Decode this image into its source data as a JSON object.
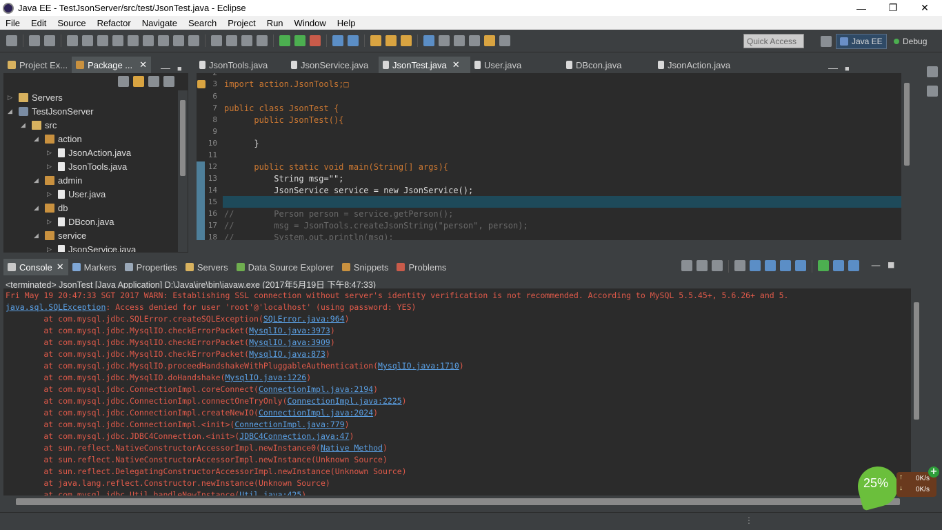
{
  "window": {
    "title": "Java EE - TestJsonServer/src/test/JsonTest.java - Eclipse",
    "minimize": "—",
    "maximize": "❐",
    "close": "✕"
  },
  "menu": [
    "File",
    "Edit",
    "Source",
    "Refactor",
    "Navigate",
    "Search",
    "Project",
    "Run",
    "Window",
    "Help"
  ],
  "toolbar": {
    "quick_access": "Quick Access",
    "perspectives": [
      "Java EE",
      "Debug"
    ]
  },
  "left_tabs": [
    {
      "label": "Project Ex..."
    },
    {
      "label": "Package ...",
      "close": "✕"
    }
  ],
  "tree": [
    {
      "label": "Servers",
      "depth": 0,
      "icon": "folder",
      "expanded": false
    },
    {
      "label": "TestJsonServer",
      "depth": 0,
      "icon": "project",
      "expanded": true
    },
    {
      "label": "src",
      "depth": 1,
      "icon": "folder",
      "expanded": true
    },
    {
      "label": "action",
      "depth": 2,
      "icon": "pkg",
      "expanded": true
    },
    {
      "label": "JsonAction.java",
      "depth": 3,
      "icon": "file",
      "expanded": false
    },
    {
      "label": "JsonTools.java",
      "depth": 3,
      "icon": "file",
      "expanded": false
    },
    {
      "label": "admin",
      "depth": 2,
      "icon": "pkg",
      "expanded": true
    },
    {
      "label": "User.java",
      "depth": 3,
      "icon": "file",
      "expanded": false
    },
    {
      "label": "db",
      "depth": 2,
      "icon": "pkg",
      "expanded": true
    },
    {
      "label": "DBcon.java",
      "depth": 3,
      "icon": "file",
      "expanded": false
    },
    {
      "label": "service",
      "depth": 2,
      "icon": "pkg",
      "expanded": true
    },
    {
      "label": "JsonService.java",
      "depth": 3,
      "icon": "file",
      "expanded": false
    }
  ],
  "editor_tabs": [
    {
      "label": "JsonTools.java",
      "active": false
    },
    {
      "label": "JsonService.java",
      "active": false
    },
    {
      "label": "JsonTest.java",
      "active": true,
      "close": "✕"
    },
    {
      "label": "User.java",
      "active": false
    },
    {
      "label": "DBcon.java",
      "active": false
    },
    {
      "label": "JsonAction.java",
      "active": false
    }
  ],
  "code_lines": [
    {
      "num": "2",
      "text": ""
    },
    {
      "num": "3",
      "text": "import action.JsonTools;□"
    },
    {
      "num": "6",
      "text": ""
    },
    {
      "num": "7",
      "text": "public class JsonTest {"
    },
    {
      "num": "8",
      "text": "      public JsonTest(){"
    },
    {
      "num": "9",
      "text": ""
    },
    {
      "num": "10",
      "text": "      }"
    },
    {
      "num": "11",
      "text": ""
    },
    {
      "num": "12",
      "text": "      public static void main(String[] args){"
    },
    {
      "num": "13",
      "text": "          String msg=\"\";"
    },
    {
      "num": "14",
      "text": "          JsonService service = new JsonService();"
    },
    {
      "num": "15",
      "text": ""
    },
    {
      "num": "16",
      "text": "//        Person person = service.getPerson();"
    },
    {
      "num": "17",
      "text": "//        msg = JsonTools.createJsonString(\"person\", person);"
    },
    {
      "num": "18",
      "text": "//        System.out.println(msg);"
    }
  ],
  "console_tabs": [
    "Console",
    "Markers",
    "Properties",
    "Servers",
    "Data Source Explorer",
    "Snippets",
    "Problems"
  ],
  "console_close": "✕",
  "console_header": "<terminated> JsonTest [Java Application] D:\\Java\\jre\\bin\\javaw.exe (2017年5月19日 下午8:47:33)",
  "console_lines": [
    {
      "pre": "Fri May 19 20:47:33 SGT 2017 WARN: Establishing SSL connection without server's identity verification is not recommended. According to MySQL 5.5.45+, 5.6.26+ and 5.",
      "link": "",
      "post": ""
    },
    {
      "pre": "",
      "link": "java.sql.SQLException",
      "post": ": Access denied for user 'root'@'localhost' (using password: YES)"
    },
    {
      "pre": "        at com.mysql.jdbc.SQLError.createSQLException(",
      "link": "SQLError.java:964",
      "post": ")"
    },
    {
      "pre": "        at com.mysql.jdbc.MysqlIO.checkErrorPacket(",
      "link": "MysqlIO.java:3973",
      "post": ")"
    },
    {
      "pre": "        at com.mysql.jdbc.MysqlIO.checkErrorPacket(",
      "link": "MysqlIO.java:3909",
      "post": ")"
    },
    {
      "pre": "        at com.mysql.jdbc.MysqlIO.checkErrorPacket(",
      "link": "MysqlIO.java:873",
      "post": ")"
    },
    {
      "pre": "        at com.mysql.jdbc.MysqlIO.proceedHandshakeWithPluggableAuthentication(",
      "link": "MysqlIO.java:1710",
      "post": ")"
    },
    {
      "pre": "        at com.mysql.jdbc.MysqlIO.doHandshake(",
      "link": "MysqlIO.java:1226",
      "post": ")"
    },
    {
      "pre": "        at com.mysql.jdbc.ConnectionImpl.coreConnect(",
      "link": "ConnectionImpl.java:2194",
      "post": ")"
    },
    {
      "pre": "        at com.mysql.jdbc.ConnectionImpl.connectOneTryOnly(",
      "link": "ConnectionImpl.java:2225",
      "post": ")"
    },
    {
      "pre": "        at com.mysql.jdbc.ConnectionImpl.createNewIO(",
      "link": "ConnectionImpl.java:2024",
      "post": ")"
    },
    {
      "pre": "        at com.mysql.jdbc.ConnectionImpl.<init>(",
      "link": "ConnectionImpl.java:779",
      "post": ")"
    },
    {
      "pre": "        at com.mysql.jdbc.JDBC4Connection.<init>(",
      "link": "JDBC4Connection.java:47",
      "post": ")"
    },
    {
      "pre": "        at sun.reflect.NativeConstructorAccessorImpl.newInstance0(",
      "link": "Native Method",
      "post": ")"
    },
    {
      "pre": "        at sun.reflect.NativeConstructorAccessorImpl.newInstance(Unknown Source)",
      "link": "",
      "post": ""
    },
    {
      "pre": "        at sun.reflect.DelegatingConstructorAccessorImpl.newInstance(Unknown Source)",
      "link": "",
      "post": ""
    },
    {
      "pre": "        at java.lang.reflect.Constructor.newInstance(Unknown Source)",
      "link": "",
      "post": ""
    },
    {
      "pre": "        at com.mysql.jdbc.Util.handleNewInstance(",
      "link": "Util.java:425",
      "post": ")"
    }
  ],
  "net_widget": {
    "percent": "25%",
    "up": "0K/s",
    "down": "0K/s",
    "add": "+"
  },
  "colors": {
    "background": "#3c3f41",
    "editor_bg": "#2b2b2b",
    "error_text": "#e05a4a",
    "link": "#5ba1e6",
    "keyword": "#cc7832",
    "type": "#3a7fd6",
    "selection": "#1e4a5a"
  }
}
